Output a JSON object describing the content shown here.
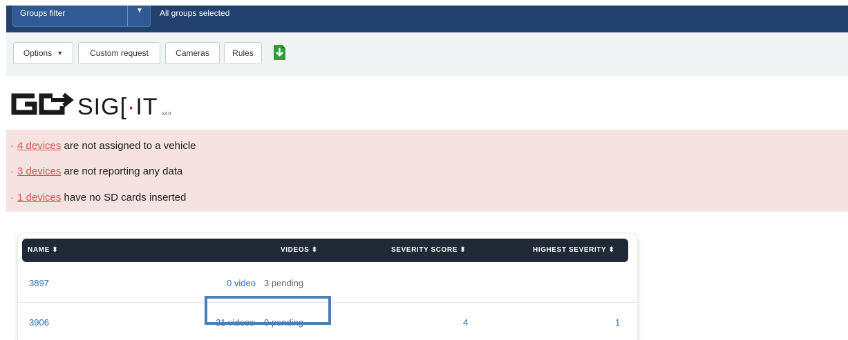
{
  "topbar": {
    "groups_filter_label": "Groups filter",
    "groups_status": "All groups selected"
  },
  "toolbar": {
    "options_label": "Options",
    "custom_request_label": "Custom request",
    "cameras_label": "Cameras",
    "rules_label": "Rules",
    "download_icon": "download-icon"
  },
  "logo": {
    "text_before": "SIG",
    "text_dot": "·",
    "text_after": "IT",
    "text_mark": "[",
    "version": "v3.0"
  },
  "alerts": [
    {
      "link": "4 devices",
      "text": "are not assigned to a vehicle"
    },
    {
      "link": "3 devices",
      "text": "are not reporting any data"
    },
    {
      "link": "1 devices",
      "text": "have no SD cards inserted"
    }
  ],
  "table": {
    "headers": [
      "NAME ⬍",
      "VIDEOS ⬍",
      "SEVERITY SCORE ⬍",
      "HIGHEST SEVERITY ⬍"
    ],
    "rows": [
      {
        "name": "3897",
        "videos": "0 video",
        "pending": "3 pending",
        "severity_score": "",
        "highest_severity": ""
      },
      {
        "name": "3906",
        "videos": "21 videos",
        "pending": "0 pending",
        "severity_score": "4",
        "highest_severity": "1"
      }
    ]
  },
  "colors": {
    "topbar": "#22416e",
    "accent_link": "#2a6ebb",
    "alert_red": "#d9534f",
    "alert_bg": "#f6e3e1",
    "highlight": "#4a7fb8"
  }
}
